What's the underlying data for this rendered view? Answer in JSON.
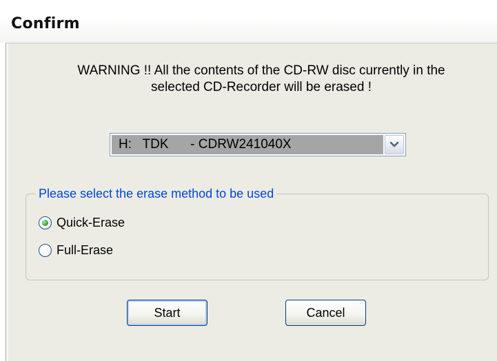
{
  "window": {
    "title": "Confirm"
  },
  "dialog": {
    "warning_line1": "WARNING !! All the contents of the CD-RW disc currently in the",
    "warning_line2": "selected CD-Recorder will be erased !",
    "recorder_select": {
      "value": "H:   TDK      - CDRW241040X",
      "icon": "chevron-down-icon"
    },
    "erase_group": {
      "label": "Please select the erase method to be used",
      "options": [
        {
          "label": "Quick-Erase",
          "checked": true
        },
        {
          "label": "Full-Erase",
          "checked": false
        }
      ]
    },
    "buttons": {
      "start_label": "Start",
      "cancel_label": "Cancel"
    }
  },
  "colors": {
    "group_label": "#0046d5",
    "dialog_bg": "#ecece5",
    "selection_bg": "#a5a5a5",
    "radio_checked": "#3aa836"
  }
}
